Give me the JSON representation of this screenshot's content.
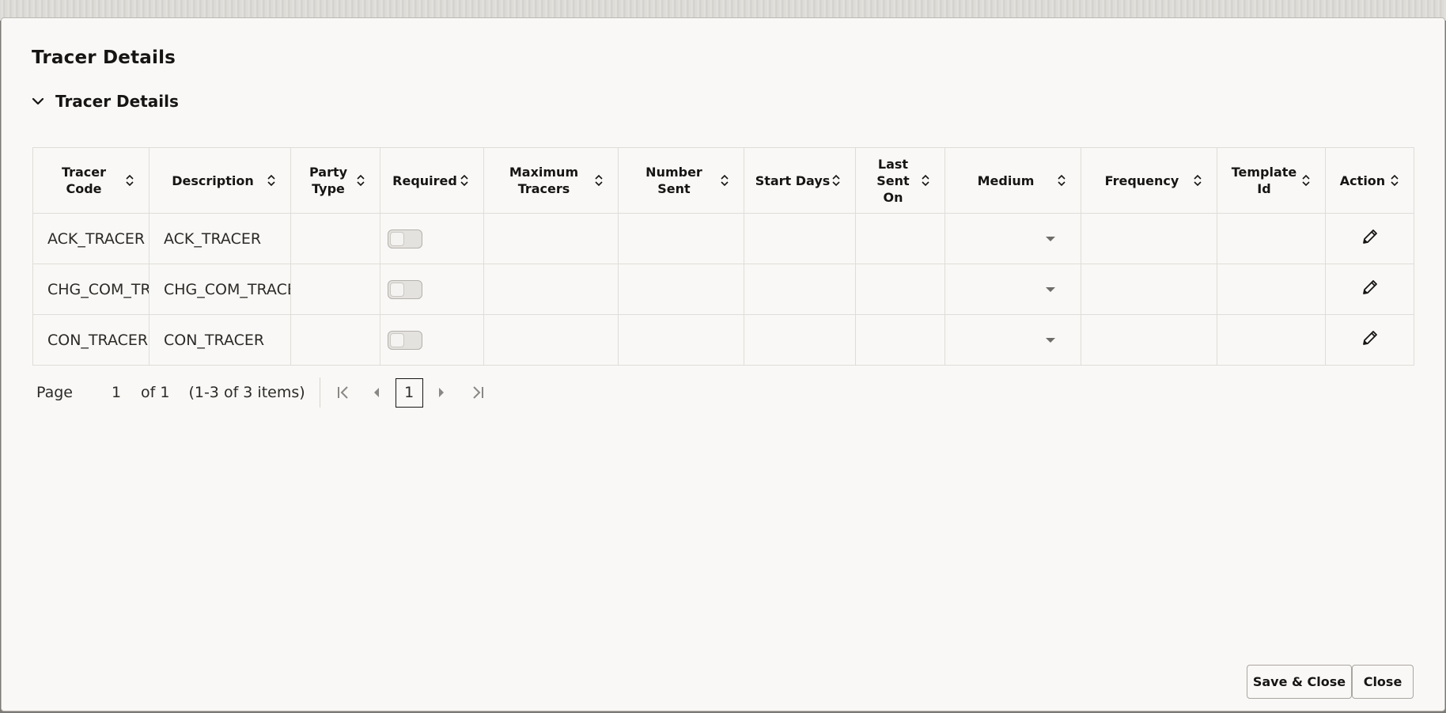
{
  "dialog": {
    "title": "Tracer Details"
  },
  "section": {
    "title": "Tracer Details",
    "expanded": true
  },
  "table": {
    "columns": [
      {
        "key": "tracer_code",
        "label": "Tracer Code"
      },
      {
        "key": "description",
        "label": "Description"
      },
      {
        "key": "party_type",
        "label": "Party Type"
      },
      {
        "key": "required",
        "label": "Required"
      },
      {
        "key": "maximum_tracers",
        "label": "Maximum Tracers"
      },
      {
        "key": "number_sent",
        "label": "Number Sent"
      },
      {
        "key": "start_days",
        "label": "Start Days"
      },
      {
        "key": "last_sent_on",
        "label": "Last Sent On"
      },
      {
        "key": "medium",
        "label": "Medium"
      },
      {
        "key": "frequency",
        "label": "Frequency"
      },
      {
        "key": "template_id",
        "label": "Template Id"
      },
      {
        "key": "action",
        "label": "Action"
      }
    ],
    "rows": [
      {
        "tracer_code": "ACK_TRACER",
        "description": "ACK_TRACER",
        "party_type": "",
        "required": false,
        "maximum_tracers": "",
        "number_sent": "",
        "start_days": "",
        "last_sent_on": "",
        "medium": "",
        "frequency": "",
        "template_id": ""
      },
      {
        "tracer_code": "CHG_COM_TRACER",
        "description": "CHG_COM_TRACER",
        "party_type": "",
        "required": false,
        "maximum_tracers": "",
        "number_sent": "",
        "start_days": "",
        "last_sent_on": "",
        "medium": "",
        "frequency": "",
        "template_id": ""
      },
      {
        "tracer_code": "CON_TRACER",
        "description": "CON_TRACER",
        "party_type": "",
        "required": false,
        "maximum_tracers": "",
        "number_sent": "",
        "start_days": "",
        "last_sent_on": "",
        "medium": "",
        "frequency": "",
        "template_id": ""
      }
    ]
  },
  "pagination": {
    "page_label": "Page",
    "current_page": "1",
    "of_label": "of 1",
    "range_label": "(1-3 of 3 items)",
    "page_button": "1"
  },
  "buttons": {
    "save_close": "Save & Close",
    "close": "Close"
  },
  "icons": {
    "section_toggle": "chevron-down-icon",
    "sort": "sort-icon",
    "select": "dropdown-arrow-icon",
    "edit": "pencil-icon",
    "first": "first-page-icon",
    "prev": "previous-page-icon",
    "next": "next-page-icon",
    "last": "last-page-icon"
  }
}
